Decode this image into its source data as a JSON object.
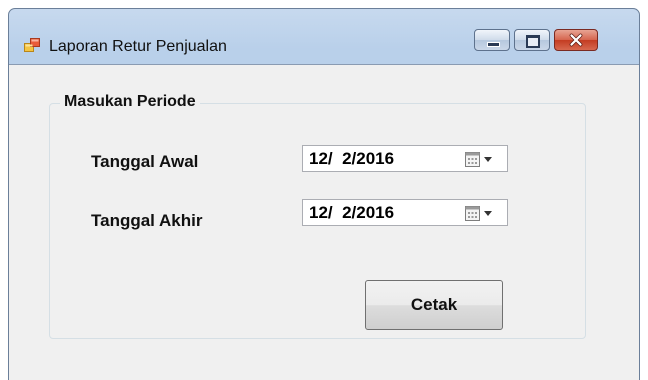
{
  "window": {
    "title": "Laporan Retur Penjualan",
    "app_icon": "form-app-icon",
    "controls": [
      "minimize-icon",
      "maximize-icon",
      "close-icon"
    ]
  },
  "group": {
    "title": "Masukan Periode"
  },
  "fields": {
    "start": {
      "label": "Tanggal Awal",
      "value": "12/  2/2016"
    },
    "end": {
      "label": "Tanggal Akhir",
      "value": "12/  2/2016"
    }
  },
  "buttons": {
    "print_label": "Cetak"
  },
  "colors": {
    "title_bar": "#b9d0ea",
    "client_bg": "#f0f0f0",
    "close_button": "#c43c22"
  }
}
